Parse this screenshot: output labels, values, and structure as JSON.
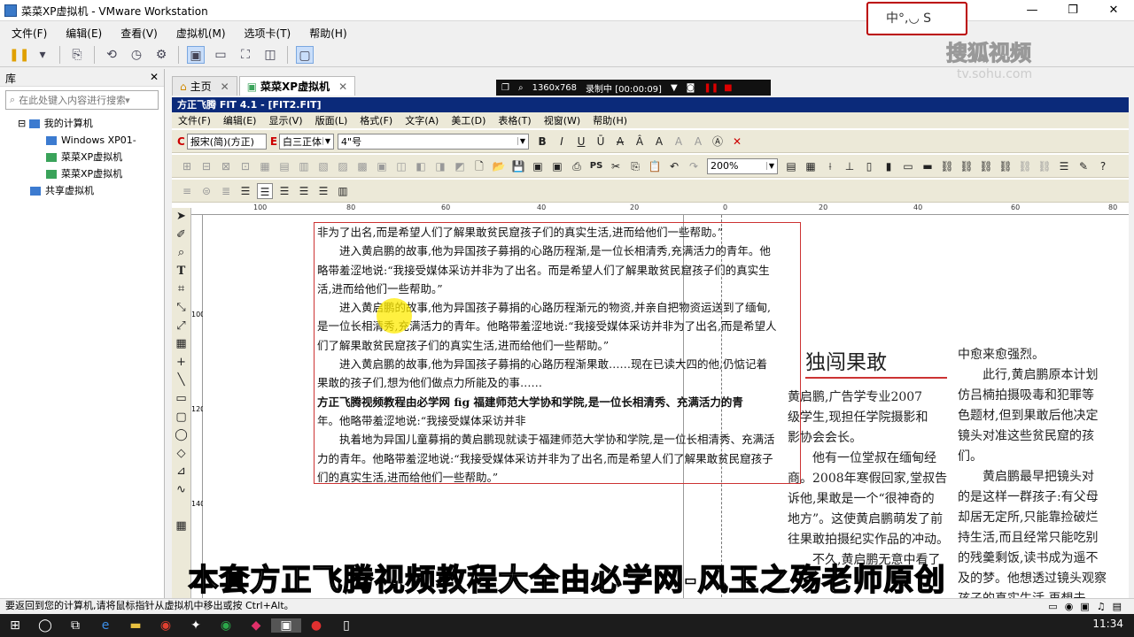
{
  "window": {
    "title": "菜菜XP虚拟机 - VMware Workstation",
    "min": "—",
    "max": "❐",
    "close": "✕"
  },
  "menu": [
    "文件(F)",
    "编辑(E)",
    "查看(V)",
    "虚拟机(M)",
    "选项卡(T)",
    "帮助(H)"
  ],
  "ime": {
    "text": "中°,◡ S"
  },
  "watermark": {
    "brand": "搜狐视频",
    "url": "tv.sohu.com"
  },
  "library": {
    "title": "库",
    "close": "✕",
    "search_placeholder": "在此处键入内容进行搜索",
    "tree": [
      {
        "label": "我的计算机",
        "expander": "⊟"
      },
      {
        "label": "Windows XP01-"
      },
      {
        "label": "菜菜XP虚拟机"
      },
      {
        "label": "菜菜XP虚拟机"
      },
      {
        "label": "共享虚拟机"
      }
    ]
  },
  "tabs": [
    {
      "label": "主页",
      "close": "✕"
    },
    {
      "label": "菜菜XP虚拟机",
      "close": "✕"
    }
  ],
  "recorder": {
    "resolution": "1360x768",
    "status": "录制中 [00:00:09]"
  },
  "fit": {
    "title": "方正飞腾 FIT 4.1 - [FIT2.FIT]",
    "menu": [
      "文件(F)",
      "编辑(E)",
      "显示(V)",
      "版面(L)",
      "格式(F)",
      "文字(A)",
      "美工(D)",
      "表格(T)",
      "视窗(W)",
      "帮助(H)"
    ],
    "font_c": "报宋(简)(方正)",
    "font_e": "白三正体",
    "size": "4\"号",
    "zoom": "200%",
    "ruler_top": [
      "100",
      "80",
      "60",
      "40",
      "20",
      "0",
      "20",
      "40",
      "60",
      "80"
    ],
    "ruler_left": [
      "100",
      "120",
      "140"
    ],
    "text_lines": [
      "非为了出名,而是希望人们了解果敢贫民窟孩子们的真实生活,进而给他们一些帮助。”",
      "　　进入黄启鹏的故事,他为异国孩子募捐的心路历程渐,是一位长相清秀,充满活力的青年。他",
      "略带羞涩地说:“我接受媒体采访并非为了出名。而是希望人们了解果敢贫民窟孩子们的真实生",
      "活,进而给他们一些帮助。”",
      "　　进入黄启鹏的故事,他为异国孩子募捐的心路历程渐元的物资,并亲自把物资运送到了缅甸,",
      "是一位长相清秀,充满活力的青年。他略带羞涩地说:“我接受媒体采访并非为了出名,而是希望人",
      "们了解果敢贫民窟孩子们的真实生活,进而给他们一些帮助。”",
      "　　进入黄启鹏的故事,他为异国孩子募捐的心路历程渐果敢……现在已读大四的他,仍惦记着",
      "果敢的孩子们,想为他们做点力所能及的事……",
      "方正飞腾视频教程由必学网 fig 福建师范大学协和学院,是一位长相清秀、充满活力的青",
      "年。他略带羞涩地说:“我接受媒体采访并非",
      "　　执着地为异国儿童募捐的黄启鹏现就读于福建师范大学协和学院,是一位长相清秀、充满活",
      "力的青年。他略带羞涩地说:“我接受媒体采访并非为了出名,而是希望人们了解果敢贫民窟孩子",
      "们的真实生活,进而给他们一些帮助。”"
    ],
    "heading": "独闯果敢",
    "col2": [
      "黄启鹏,广告学专业2007",
      "级学生,现担任学院摄影和",
      "影协会会长。",
      "　　他有一位堂叔在缅甸经",
      "商。2008年寒假回家,堂叔告",
      "诉他,果敢是一个“很神奇的",
      "地方”。这使黄启鹏萌发了前",
      "往果敢拍摄纪实作品的冲动。",
      "　　不久,黄启鹏无意中看了"
    ],
    "col3": [
      "中愈来愈强烈。",
      "　　此行,黄启鹏原本计划",
      "仿吕楠拍摄吸毒和犯罪等",
      "色题材,但到果敢后他决定",
      "镜头对准这些贫民窟的孩",
      "们。",
      "　　黄启鹏最早把镜头对",
      "的是这样一群孩子:有父母",
      "却居无定所,只能靠捡破烂",
      "持生活,而且经常只能吃别",
      "的残羹剩饭,读书成为遥不",
      "及的梦。他想透过镜头观察",
      "孩子的真实生活,再想去"
    ]
  },
  "subtitle": "本套方正飞腾视频教程大全由必学网-风玉之殇老师原创",
  "status": "要返回到您的计算机,请将鼠标指针从虚拟机中移出或按 Ctrl+Alt。",
  "clock": "11:34"
}
